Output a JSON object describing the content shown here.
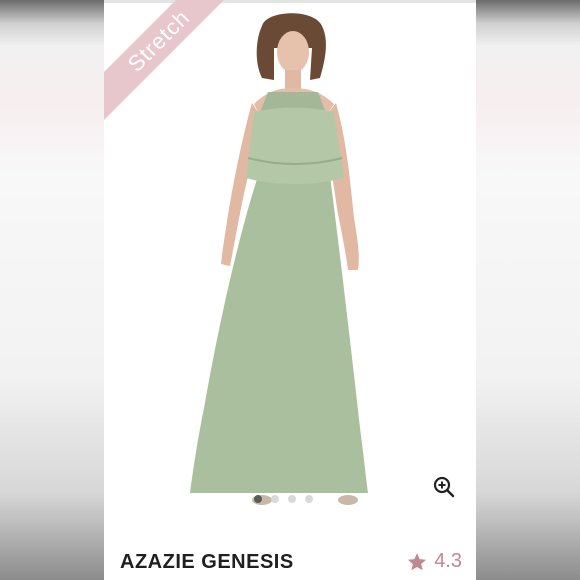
{
  "badge": {
    "label": "Stretch"
  },
  "product": {
    "name": "AZAZIE GENESIS",
    "rating": "4.3"
  },
  "gallery": {
    "slide_count": 4,
    "active_index": 0
  },
  "colors": {
    "ribbon": "#e8c7cc",
    "rating": "#c4868f",
    "dress": "#a9bf9d"
  },
  "icons": {
    "zoom": "zoom-in-icon",
    "rating": "star-icon"
  }
}
